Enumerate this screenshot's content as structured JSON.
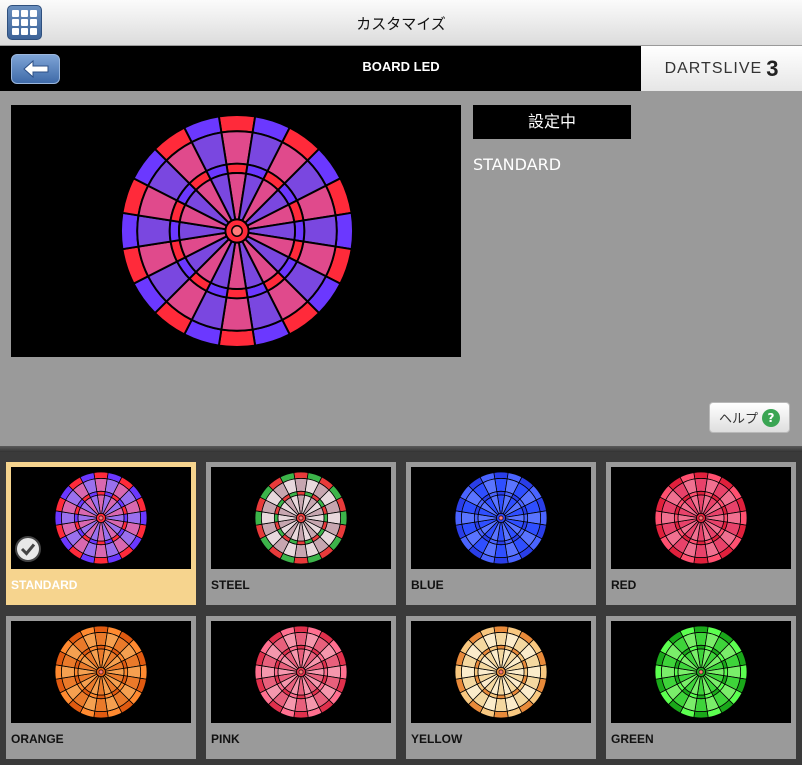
{
  "topbar": {
    "title": "カスタマイズ"
  },
  "header": {
    "title": "BOARD LED",
    "logo_text": "DARTSLIVE",
    "logo_num": "3"
  },
  "preview": {
    "status": "設定中",
    "current_name": "STANDARD",
    "colors": {
      "a": "#e04a8c",
      "b": "#7a47e0",
      "ring1": "#ff2a3a",
      "ring2": "#6b38ff"
    }
  },
  "help": {
    "label": "ヘルプ"
  },
  "themes": [
    {
      "label": "STANDARD",
      "selected": true,
      "a": "#d968b0",
      "b": "#9a70ee",
      "r1": "#ff2a3a",
      "r2": "#6b38ff"
    },
    {
      "label": "STEEL",
      "selected": false,
      "a": "#c7a6b0",
      "b": "#e8d8dc",
      "r1": "#e83a3a",
      "r2": "#3cb44a"
    },
    {
      "label": "BLUE",
      "selected": false,
      "a": "#2f4fff",
      "b": "#5a74ff",
      "r1": "#2a3ee8",
      "r2": "#4a64ff"
    },
    {
      "label": "RED",
      "selected": false,
      "a": "#e8426a",
      "b": "#f07090",
      "r1": "#e0203c",
      "r2": "#ff5070"
    },
    {
      "label": "ORANGE",
      "selected": false,
      "a": "#ea7a2a",
      "b": "#f5a050",
      "r1": "#e05a10",
      "r2": "#ff8a30"
    },
    {
      "label": "PINK",
      "selected": false,
      "a": "#e8607c",
      "b": "#f597ad",
      "r1": "#e0304c",
      "r2": "#ff7090"
    },
    {
      "label": "YELLOW",
      "selected": false,
      "a": "#f4d8a0",
      "b": "#fbeccb",
      "r1": "#e88a3a",
      "r2": "#f8c880"
    },
    {
      "label": "GREEN",
      "selected": false,
      "a": "#3ed43a",
      "b": "#7aee6a",
      "r1": "#1aa81a",
      "r2": "#5cff50"
    }
  ]
}
